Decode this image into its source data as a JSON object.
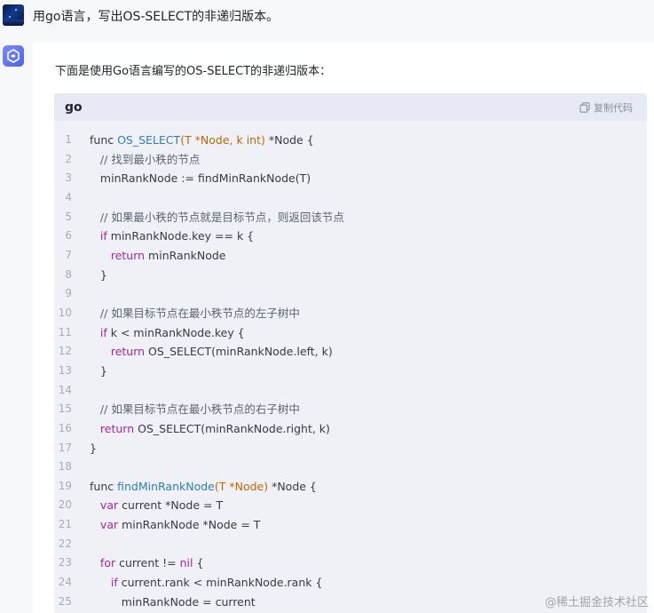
{
  "user_message": {
    "avatar_icon": "night-landscape-avatar",
    "text": "用go语言，写出OS-SELECT的非递归版本。"
  },
  "assistant": {
    "avatar_icon": "cube-logo-icon",
    "intro": "下面是使用Go语言编写的OS-SELECT的非递归版本：",
    "code_block": {
      "language": "go",
      "copy_label": "复制代码",
      "lines": [
        {
          "n": "1",
          "html": "func <span class=\"fn\">OS_SELECT</span><span class=\"param\">(T *Node, k int)</span> *Node {"
        },
        {
          "n": "2",
          "html": "   <span class=\"cm\">// 找到最小秩的节点</span>"
        },
        {
          "n": "3",
          "html": "   minRankNode := findMinRankNode(T)"
        },
        {
          "n": "4",
          "html": ""
        },
        {
          "n": "5",
          "html": "   <span class=\"cm\">// 如果最小秩的节点就是目标节点，则返回该节点</span>"
        },
        {
          "n": "6",
          "html": "   <span class=\"kw\">if</span> minRankNode.key == k {"
        },
        {
          "n": "7",
          "html": "      <span class=\"kw\">return</span> minRankNode"
        },
        {
          "n": "8",
          "html": "   }"
        },
        {
          "n": "9",
          "html": ""
        },
        {
          "n": "10",
          "html": "   <span class=\"cm\">// 如果目标节点在最小秩节点的左子树中</span>"
        },
        {
          "n": "11",
          "html": "   <span class=\"kw\">if</span> k &lt; minRankNode.key {"
        },
        {
          "n": "12",
          "html": "      <span class=\"kw\">return</span> OS_SELECT(minRankNode.left, k)"
        },
        {
          "n": "13",
          "html": "   }"
        },
        {
          "n": "14",
          "html": ""
        },
        {
          "n": "15",
          "html": "   <span class=\"cm\">// 如果目标节点在最小秩节点的右子树中</span>"
        },
        {
          "n": "16",
          "html": "   <span class=\"kw\">return</span> OS_SELECT(minRankNode.right, k)"
        },
        {
          "n": "17",
          "html": "}"
        },
        {
          "n": "18",
          "html": ""
        },
        {
          "n": "19",
          "html": "func <span class=\"fn\">findMinRankNode</span><span class=\"param\">(T *Node)</span> *Node {"
        },
        {
          "n": "20",
          "html": "   <span class=\"kw\">var</span> current *Node = T"
        },
        {
          "n": "21",
          "html": "   <span class=\"kw\">var</span> minRankNode *Node = T"
        },
        {
          "n": "22",
          "html": ""
        },
        {
          "n": "23",
          "html": "   <span class=\"kw\">for</span> current != <span class=\"kw\">nil</span> {"
        },
        {
          "n": "24",
          "html": "      <span class=\"kw\">if</span> current.rank &lt; minRankNode.rank {"
        },
        {
          "n": "25",
          "html": "         minRankNode = current"
        }
      ]
    }
  },
  "watermark": "@稀土掘金技术社区",
  "colors": {
    "page_bg": "#f7f8fa",
    "code_bg": "#f0f1f6",
    "code_header_bg": "#e7e9f4",
    "keyword": "#a626a4",
    "function": "#2d7fb8",
    "params": "#b76b01",
    "comment": "#5c6370"
  }
}
